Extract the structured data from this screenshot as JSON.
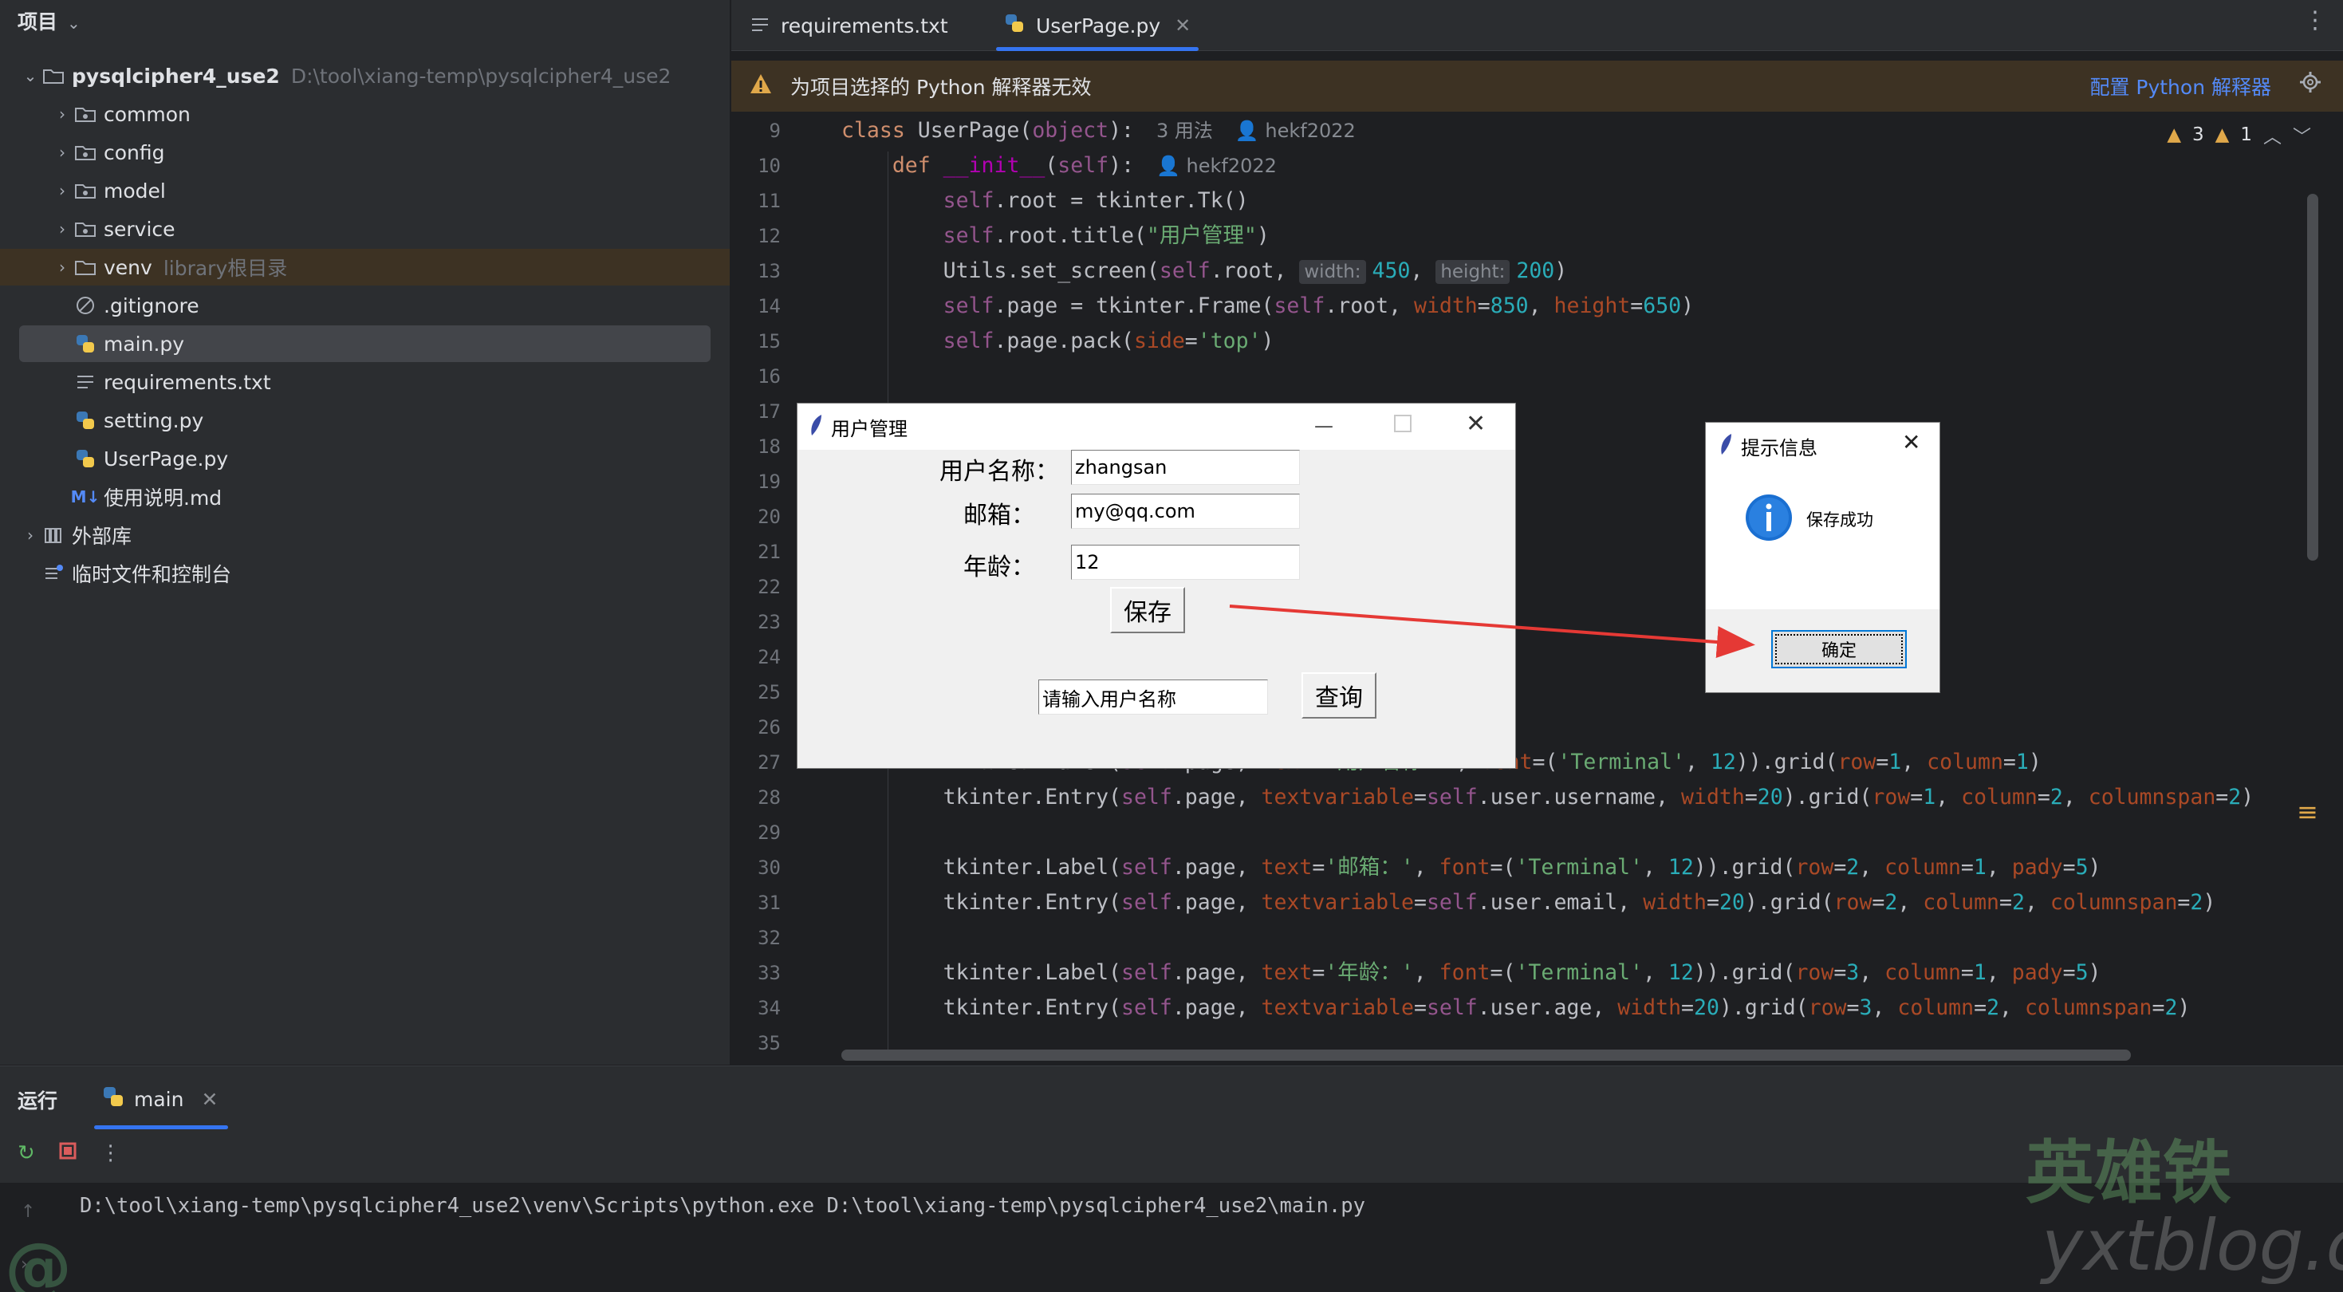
{
  "project": {
    "title": "项目",
    "root_name": "pysqlcipher4_use2",
    "root_path": "D:\\tool\\xiang-temp\\pysqlcipher4_use2",
    "items": [
      {
        "label": "common"
      },
      {
        "label": "config"
      },
      {
        "label": "model"
      },
      {
        "label": "service"
      },
      {
        "label": "venv",
        "sub": "library根目录"
      },
      {
        "label": ".gitignore"
      },
      {
        "label": "main.py"
      },
      {
        "label": "requirements.txt"
      },
      {
        "label": "setting.py"
      },
      {
        "label": "UserPage.py"
      },
      {
        "label": "使用说明.md"
      },
      {
        "label": "外部库"
      },
      {
        "label": "临时文件和控制台"
      }
    ]
  },
  "editor": {
    "tabs": [
      {
        "label": "requirements.txt"
      },
      {
        "label": "UserPage.py"
      }
    ],
    "warning": "为项目选择的 Python 解释器无效",
    "configure_link": "配置 Python 解释器",
    "inspections": {
      "warnings": "3",
      "weak_warnings": "1"
    },
    "hints": {
      "usages": "3 用法",
      "author": "hekf2022",
      "width": "width:",
      "height": "height:"
    },
    "line_numbers": [
      "9",
      "10",
      "11",
      "12",
      "13",
      "14",
      "15",
      "16",
      "17",
      "18",
      "19",
      "20",
      "21",
      "22",
      "23",
      "24",
      "25",
      "26",
      "27",
      "28",
      "29",
      "30",
      "31",
      "32",
      "33",
      "34",
      "35"
    ]
  },
  "user_window": {
    "title": "用户管理",
    "name_label": "用户名称：",
    "name_value": "zhangsan",
    "email_label": "邮箱：",
    "email_value": "my@qq.com",
    "age_label": "年龄：",
    "age_value": "12",
    "save_button": "保存",
    "search_value": "请输入用户名称",
    "query_button": "查询"
  },
  "message_box": {
    "title": "提示信息",
    "message": "保存成功",
    "ok_button": "确定"
  },
  "run": {
    "title": "运行",
    "tab": "main",
    "command": "D:\\tool\\xiang-temp\\pysqlcipher4_use2\\venv\\Scripts\\python.exe D:\\tool\\xiang-temp\\pysqlcipher4_use2\\main.py"
  },
  "watermark": {
    "brand": "英雄铁",
    "site": "yxtblog.com",
    "handle": "@"
  },
  "colors": {
    "accent": "#3574f0",
    "warning_bg": "#3d3223",
    "link": "#548af7",
    "arrow": "#e53935"
  }
}
